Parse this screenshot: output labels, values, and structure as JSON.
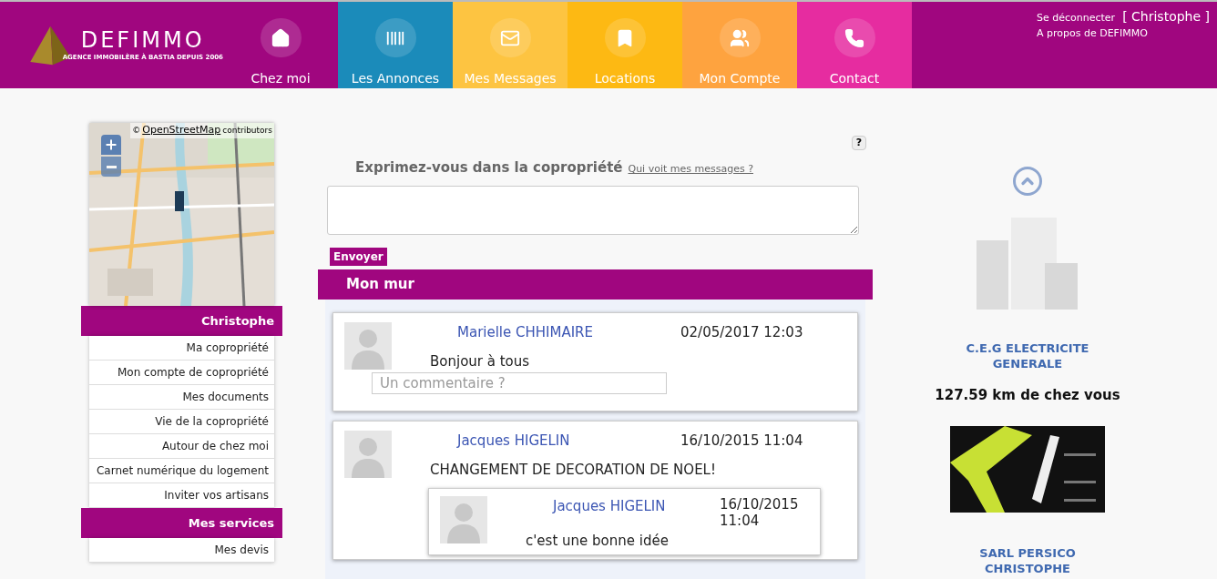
{
  "brand": {
    "name": "DEFIMMO",
    "tagline": "AGENCE IMMOBILÈRE À BASTIA DEPUIS 2006"
  },
  "nav": [
    {
      "label": "Chez moi",
      "kind": "home",
      "color": "#a0067f"
    },
    {
      "label": "Les Annonces",
      "kind": "barcode",
      "color": "#1b8bba"
    },
    {
      "label": "Mes Messages",
      "kind": "mail",
      "color": "#fdc441"
    },
    {
      "label": "Locations",
      "kind": "bookmark",
      "color": "#fdb913"
    },
    {
      "label": "Mon Compte",
      "kind": "users",
      "color": "#fea33f"
    },
    {
      "label": "Contact",
      "kind": "phone",
      "color": "#e62ca0"
    }
  ],
  "account": {
    "logout": "Se déconnecter",
    "user": "[ Christophe ]",
    "about": "A propos de DEFIMMO"
  },
  "map": {
    "attribution_symbol": "©",
    "attribution_link": "OpenStreetMap",
    "attribution_rest": "contributors"
  },
  "sidebar": [
    {
      "title": "Christophe",
      "items": [
        "Ma copropriété",
        "Mon compte de copropriété",
        "Mes documents",
        "Vie de la copropriété",
        "Autour de chez moi",
        "Carnet numérique du logement",
        "Inviter vos artisans"
      ]
    },
    {
      "title": "Mes services",
      "items": [
        "Mes devis"
      ]
    }
  ],
  "composer": {
    "title": "Exprimez-vous dans la copropriété",
    "link": "Qui voit mes messages ?",
    "submit": "Envoyer",
    "help": "?"
  },
  "wall": {
    "title": "Mon mur",
    "posts": [
      {
        "author": "Marielle CHHIMAIRE",
        "date": "02/05/2017 12:03",
        "message": "Bonjour à tous",
        "comment_placeholder": "Un commentaire ?"
      },
      {
        "author": "Jacques HIGELIN",
        "date": "16/10/2015 11:04",
        "message": "CHANGEMENT DE DECORATION DE NOEL!",
        "replies": [
          {
            "author": "Jacques HIGELIN",
            "date": "16/10/2015 11:04",
            "message": "c'est une bonne idée"
          }
        ]
      }
    ]
  },
  "artisans": [
    {
      "name": "C.E.G ELECTRICITE GENERALE",
      "distance": "127.59 km de chez vous",
      "kind": "building"
    },
    {
      "name": "SARL PERSICO CHRISTOPHE",
      "kind": "picture"
    }
  ]
}
